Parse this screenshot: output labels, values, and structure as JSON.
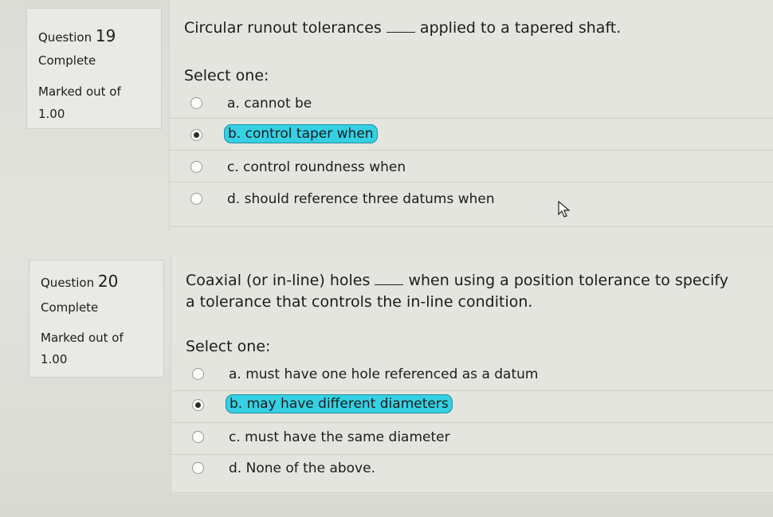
{
  "questions": [
    {
      "label": "Question",
      "number": "19",
      "status": "Complete",
      "marked_label": "Marked out of",
      "marked_value": "1.00",
      "text_before": "Circular runout tolerances",
      "text_after": "applied to a tapered shaft.",
      "prompt": "Select one:",
      "options": [
        {
          "text": "a. cannot be",
          "selected": false
        },
        {
          "text": "b. control taper when",
          "selected": true
        },
        {
          "text": "c. control roundness when",
          "selected": false
        },
        {
          "text": "d. should reference three datums when",
          "selected": false
        }
      ]
    },
    {
      "label": "Question",
      "number": "20",
      "status": "Complete",
      "marked_label": "Marked out of",
      "marked_value": "1.00",
      "text_before": "Coaxial (or in-line) holes",
      "text_after": "when using a position tolerance to specify",
      "text_line2": "a tolerance that controls the in-line condition.",
      "prompt": "Select one:",
      "options": [
        {
          "text": "a. must have one hole referenced as a datum",
          "selected": false
        },
        {
          "text": "b. may have different diameters",
          "selected": true
        },
        {
          "text": "c. must have the same diameter",
          "selected": false
        },
        {
          "text": "d. None of the above.",
          "selected": false
        }
      ]
    }
  ],
  "colors": {
    "selected_highlight": "#35d0e4",
    "background": "#dcdcd6"
  },
  "icons": {
    "cursor": "mouse-pointer-icon",
    "radio": "radio-button-icon"
  }
}
